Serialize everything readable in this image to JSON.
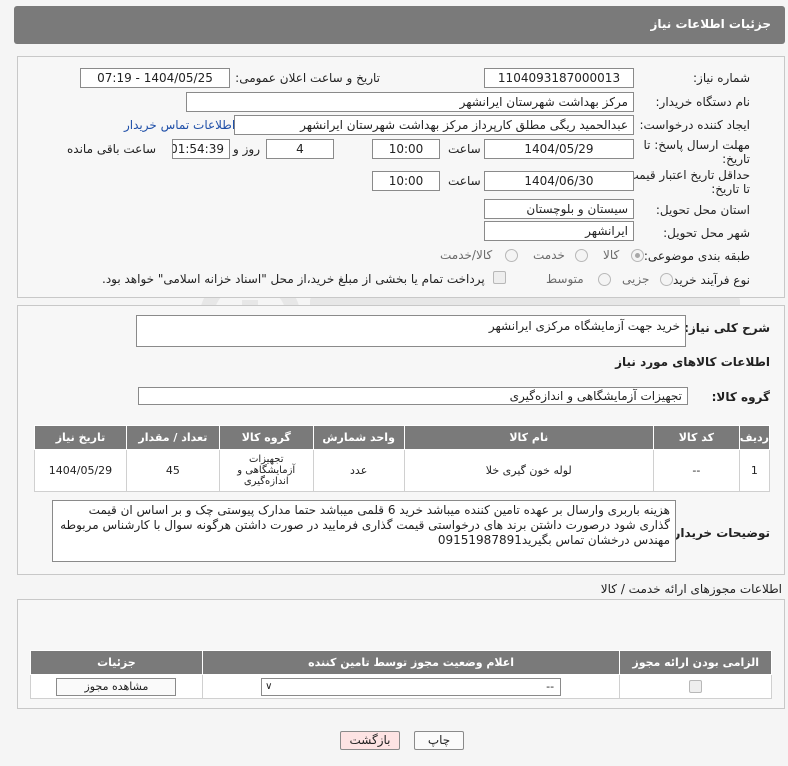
{
  "header": {
    "title": "جزئیات اطلاعات نیاز"
  },
  "form": {
    "need_number_label": "شماره نیاز:",
    "need_number": "1104093187000013",
    "announce_label": "تاریخ و ساعت اعلان عمومی:",
    "announce_value": "1404/05/25 - 07:19",
    "buyer_org_label": "نام دستگاه خریدار:",
    "buyer_org": "مرکز بهداشت شهرستان ایرانشهر",
    "creator_label": "ایجاد کننده درخواست:",
    "creator": "عبدالحمید ریگی مطلق کارپرداز مرکز بهداشت شهرستان ایرانشهر",
    "contact_link": "اطلاعات تماس خریدار",
    "deadline_label_1": "مهلت ارسال پاسخ: تا",
    "deadline_label_2": "تاریخ:",
    "deadline_date": "1404/05/29",
    "time_label": "ساعت",
    "deadline_time": "10:00",
    "days_value": "4",
    "days_label": "روز و",
    "remaining_time": "01:54:39",
    "remaining_label": "ساعت باقی مانده",
    "min_validity_label_1": "حداقل تاریخ اعتبار قیمت:",
    "min_validity_label_2": "تا تاریخ:",
    "validity_date": "1404/06/30",
    "validity_time": "10:00",
    "province_label": "استان محل تحویل:",
    "province": "سیستان و بلوچستان",
    "city_label": "شهر محل تحویل:",
    "city": "ایرانشهر",
    "category_label": "طبقه بندی موضوعی:",
    "category_options": [
      "کالا",
      "خدمت",
      "کالا/خدمت"
    ],
    "process_label": "نوع فرآیند خرید :",
    "process_options": [
      "جزیی",
      "متوسط"
    ],
    "payment_note": "پرداخت تمام یا بخشی از مبلغ خرید،از محل \"اسناد خزانه اسلامی\" خواهد بود."
  },
  "summary": {
    "label": "شرح کلی نیاز:",
    "value": "خرید جهت آزمایشگاه مرکزی ایرانشهر"
  },
  "goods_info": {
    "title": "اطلاعات کالاهای مورد نیاز",
    "group_label": "گروه کالا:",
    "group_value": "تجهیزات آزمایشگاهی و اندازه‌گیری",
    "columns": [
      "ردیف",
      "کد کالا",
      "نام کالا",
      "واحد شمارش",
      "گروه کالا",
      "تعداد / مقدار",
      "تاریخ نیاز"
    ],
    "rows": [
      {
        "row": "1",
        "code": "--",
        "name": "لوله خون گیری خلا",
        "unit": "عدد",
        "group": "تجهیزات آزمایشگاهی و اندازه‌گیری",
        "qty": "45",
        "date": "1404/05/29"
      }
    ]
  },
  "buyer_notes": {
    "label": "توضیحات خریدار:",
    "value": "هزینه باربری وارسال بر عهده تامین کننده میباشد  خرید 6 قلمی میباشد حتما مدارک پیوستی چک و بر اساس ان قیمت گذاری شود درصورت داشتن برند های درخواستی قیمت گذاری فرمایید در صورت داشتن هرگونه سوال با کارشناس مربوطه مهندس درخشان تماس بگیرید09151987891"
  },
  "permits": {
    "title": "اطلاعات مجوزهای ارائه خدمت / کالا",
    "columns": [
      "الزامی بودن ارائه مجوز",
      "اعلام وضعیت مجوز توسط تامین کننده",
      "جزئیات"
    ],
    "select_value": "--",
    "view_button": "مشاهده مجوز"
  },
  "footer": {
    "print_button": "چاپ",
    "back_button": "بازگشت"
  },
  "colors": {
    "header_bg": "#7a7a7a",
    "link": "#1f4fa8",
    "back_bg": "#fde3e3"
  }
}
